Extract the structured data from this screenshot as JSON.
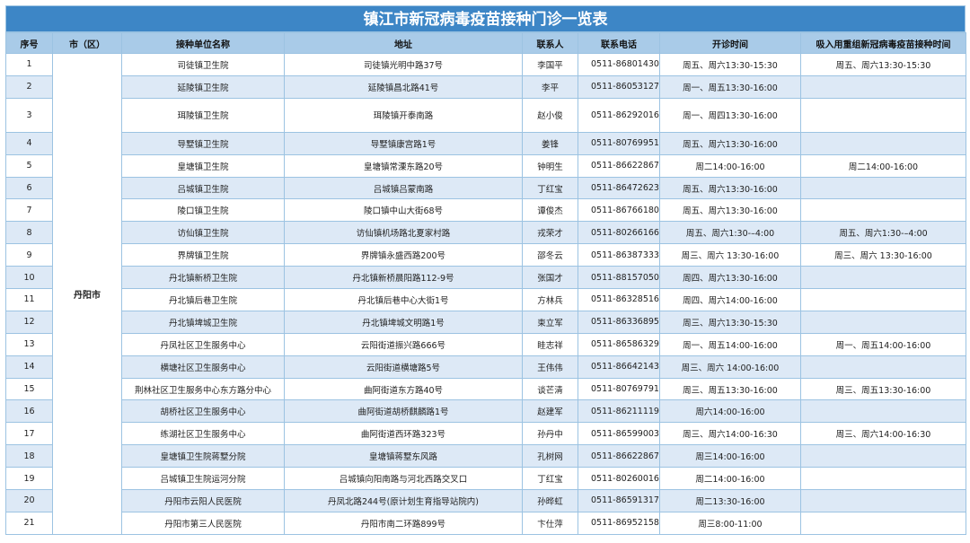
{
  "title": "镇江市新冠病毒疫苗接种门诊一览表",
  "headers": [
    "序号",
    "市（区）",
    "接种单位名称",
    "地址",
    "联系人",
    "联系电话",
    "开诊时间",
    "吸入用重组新冠病毒疫苗接种时间"
  ],
  "city": "丹阳市",
  "rows": [
    [
      "1",
      "司徒镇卫生院",
      "司徒镇光明中路37号",
      "李国平",
      "0511-86801430",
      "周五、周六13:30-15:30",
      "周五、周六13:30-15:30"
    ],
    [
      "2",
      "延陵镇卫生院",
      "延陵镇昌北路41号",
      "李平",
      "0511-86053127",
      "周一、周五13:30-16:00",
      ""
    ],
    [
      "3",
      "珥陵镇卫生院",
      "珥陵镇开泰南路",
      "赵小俊",
      "0511-86292016",
      "周一、周四13:30-16:00",
      ""
    ],
    [
      "4",
      "导墅镇卫生院",
      "导墅镇康宫路1号",
      "姜锋",
      "0511-80769951",
      "周五、周六13:30-16:00",
      ""
    ],
    [
      "5",
      "皇塘镇卫生院",
      "皇塘镇常溧东路20号",
      "钟明生",
      "0511-86622867",
      "周二14:00-16:00",
      "周二14:00-16:00"
    ],
    [
      "6",
      "吕城镇卫生院",
      "吕城镇吕蒙南路",
      "丁红宝",
      "0511-86472623",
      "周五、周六13:30-16:00",
      ""
    ],
    [
      "7",
      "陵口镇卫生院",
      "陵口镇中山大街68号",
      "谭俊杰",
      "0511-86766180",
      "周五、周六13:30-16:00",
      ""
    ],
    [
      "8",
      "访仙镇卫生院",
      "访仙镇机场路北夏家村路",
      "戎荣才",
      "0511-80266166",
      "周五、周六1:30-–4:00",
      "周五、周六1:30-–4:00"
    ],
    [
      "9",
      "界牌镇卫生院",
      "界牌镇永盛西路200号",
      "邵冬云",
      "0511-86387333",
      "周三、周六 13:30-16:00",
      "周三、周六 13:30-16:00"
    ],
    [
      "10",
      "丹北镇新桥卫生院",
      "丹北镇新桥晨阳路112-9号",
      "张国才",
      "0511-88157050",
      "周四、周六13:30-16:00",
      ""
    ],
    [
      "11",
      "丹北镇后巷卫生院",
      "丹北镇后巷中心大街1号",
      "方林兵",
      "0511-86328516",
      "周四、周六14:00-16:00",
      ""
    ],
    [
      "12",
      "丹北镇埤城卫生院",
      "丹北镇埤城文明路1号",
      "束立军",
      "0511-86336895",
      "周三、周六13:30-15:30",
      ""
    ],
    [
      "13",
      "丹凤社区卫生服务中心",
      "云阳街道振兴路666号",
      "眭志祥",
      "0511-86586329",
      "周一、周五14:00-16:00",
      "周一、周五14:00-16:00"
    ],
    [
      "14",
      "横塘社区卫生服务中心",
      "云阳街道横塘路5号",
      "王伟伟",
      "0511-86642143",
      "周三、周六 14:00-16:00",
      ""
    ],
    [
      "15",
      "荆林社区卫生服务中心东方路分中心",
      "曲阿街道东方路40号",
      "谈芒清",
      "0511-80769791",
      "周三、周五13:30-16:00",
      "周三、周五13:30-16:00"
    ],
    [
      "16",
      "胡桥社区卫生服务中心",
      "曲阿街道胡桥麒麟路1号",
      "赵建军",
      "0511-86211119",
      "周六14:00-16:00",
      ""
    ],
    [
      "17",
      "练湖社区卫生服务中心",
      "曲阿街道西环路323号",
      "孙丹中",
      "0511-86599003",
      "周三、周六14:00-16:30",
      "周三、周六14:00-16:30"
    ],
    [
      "18",
      "皇塘镇卫生院蒋墅分院",
      "皇塘镇蒋墅东风路",
      "孔树网",
      "0511-86622867",
      "周三14:00-16:00",
      ""
    ],
    [
      "19",
      "吕城镇卫生院运河分院",
      "吕城镇向阳南路与河北西路交叉口",
      "丁红宝",
      "0511-80260016",
      "周二14:00-16:00",
      ""
    ],
    [
      "20",
      "丹阳市云阳人民医院",
      "丹凤北路244号(原计划生育指导站院内)",
      "孙晔虹",
      "0511-86591317",
      "周二13:30-16:00",
      ""
    ],
    [
      "21",
      "丹阳市第三人民医院",
      "丹阳市南二环路899号",
      "卞仕萍",
      "0511-86952158",
      "周三8:00-11:00",
      ""
    ]
  ]
}
